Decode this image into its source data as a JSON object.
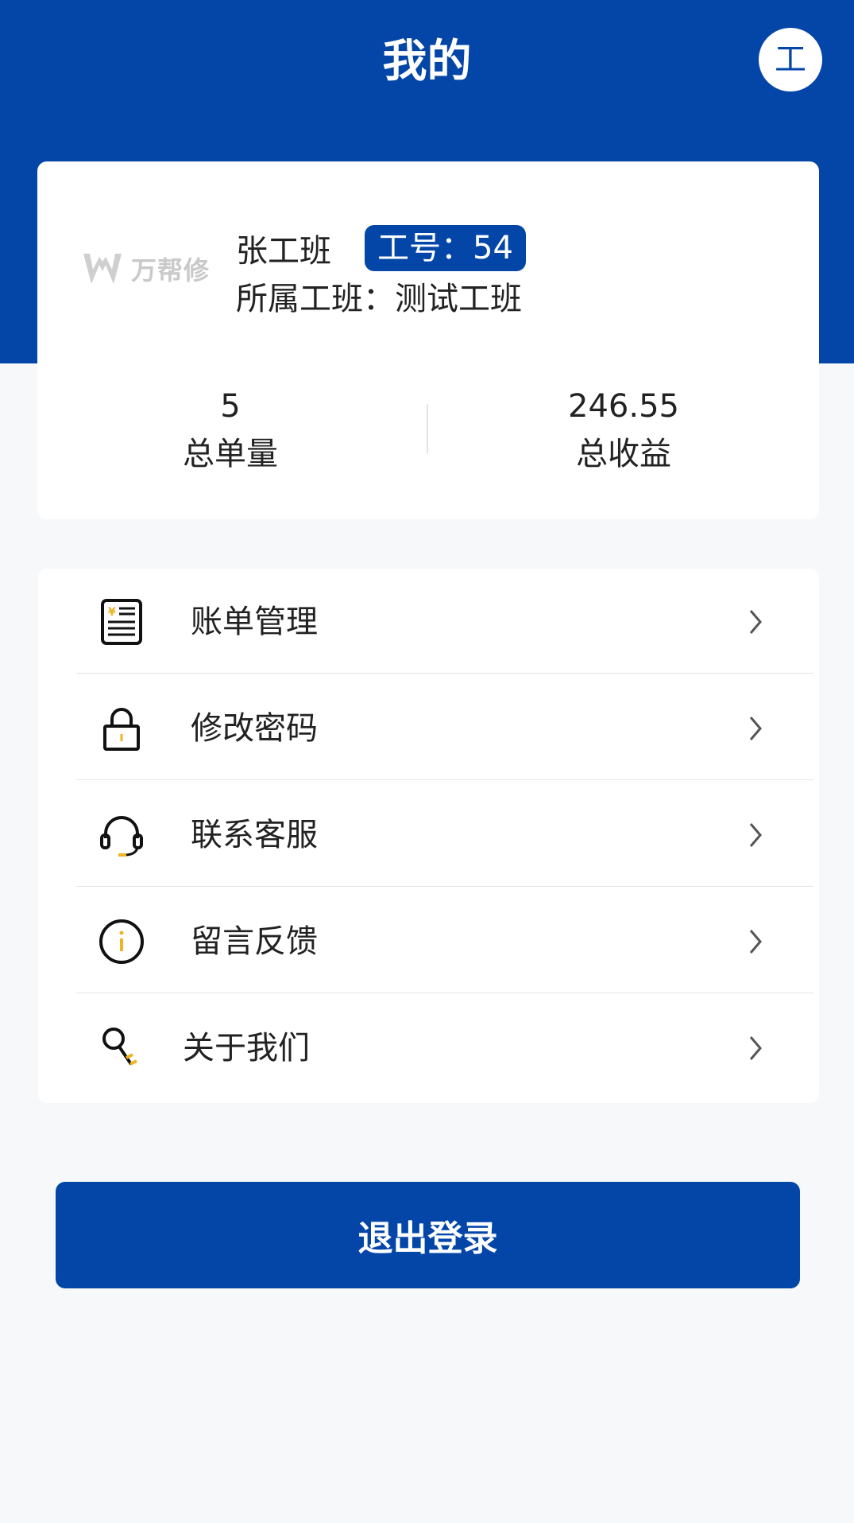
{
  "header": {
    "title": "我的",
    "avatar_text": "工"
  },
  "profile": {
    "logo_text": "万帮修",
    "name": "张工班",
    "badge": "工号：54",
    "team": "所属工班：测试工班",
    "stats": [
      {
        "value": "5",
        "label": "总单量"
      },
      {
        "value": "246.55",
        "label": "总收益"
      }
    ]
  },
  "menu": {
    "items": [
      {
        "label": "账单管理",
        "icon": "bill-icon"
      },
      {
        "label": "修改密码",
        "icon": "lock-icon"
      },
      {
        "label": "联系客服",
        "icon": "headset-icon"
      },
      {
        "label": "留言反馈",
        "icon": "info-icon"
      },
      {
        "label": "关于我们",
        "icon": "key-icon"
      }
    ]
  },
  "logout_label": "退出登录",
  "colors": {
    "primary": "#0346a8",
    "accent": "#f0b323",
    "background": "#f7f8fa"
  }
}
